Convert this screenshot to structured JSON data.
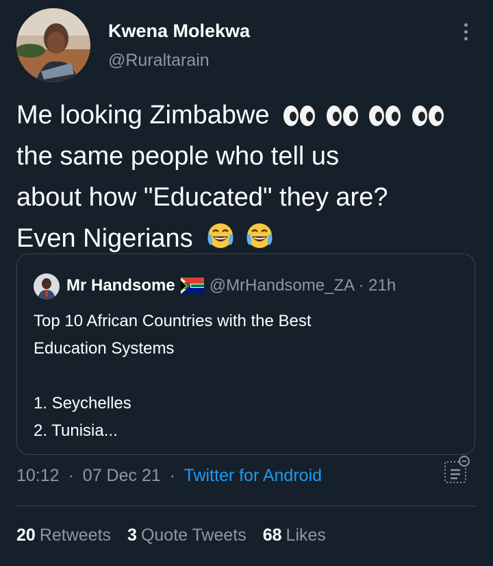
{
  "author": {
    "display_name": "Kwena Molekwa",
    "handle": "@Ruraltarain"
  },
  "tweet": {
    "text_lines": [
      "Me looking Zimbabwe",
      "the same people who tell us",
      "about how \"Educated\" they are?",
      "Even Nigerians"
    ],
    "emoji": {
      "line1": [
        "eyes-icon",
        "eyes-icon",
        "eyes-icon",
        "eyes-icon"
      ],
      "line4": [
        "joy-icon",
        "joy-icon"
      ]
    }
  },
  "quote": {
    "display_name": "Mr Handsome",
    "flag": "south-africa-flag-icon",
    "handle_time": "@MrHandsome_ZA · 21h",
    "body_lines": [
      "Top 10 African Countries with the Best",
      "Education Systems",
      "",
      "1. Seychelles",
      "2. Tunisia..."
    ]
  },
  "meta": {
    "time": "10:12",
    "date": "07 Dec 21",
    "separator": "·",
    "source": "Twitter for Android"
  },
  "stats": {
    "retweets_count": "20",
    "retweets_label": "Retweets",
    "quotes_count": "3",
    "quotes_label": "Quote Tweets",
    "likes_count": "68",
    "likes_label": "Likes"
  },
  "colors": {
    "background": "#15202b",
    "text": "#ffffff",
    "muted": "#8b98a5",
    "link": "#1d9bf0",
    "border": "#38444d"
  }
}
